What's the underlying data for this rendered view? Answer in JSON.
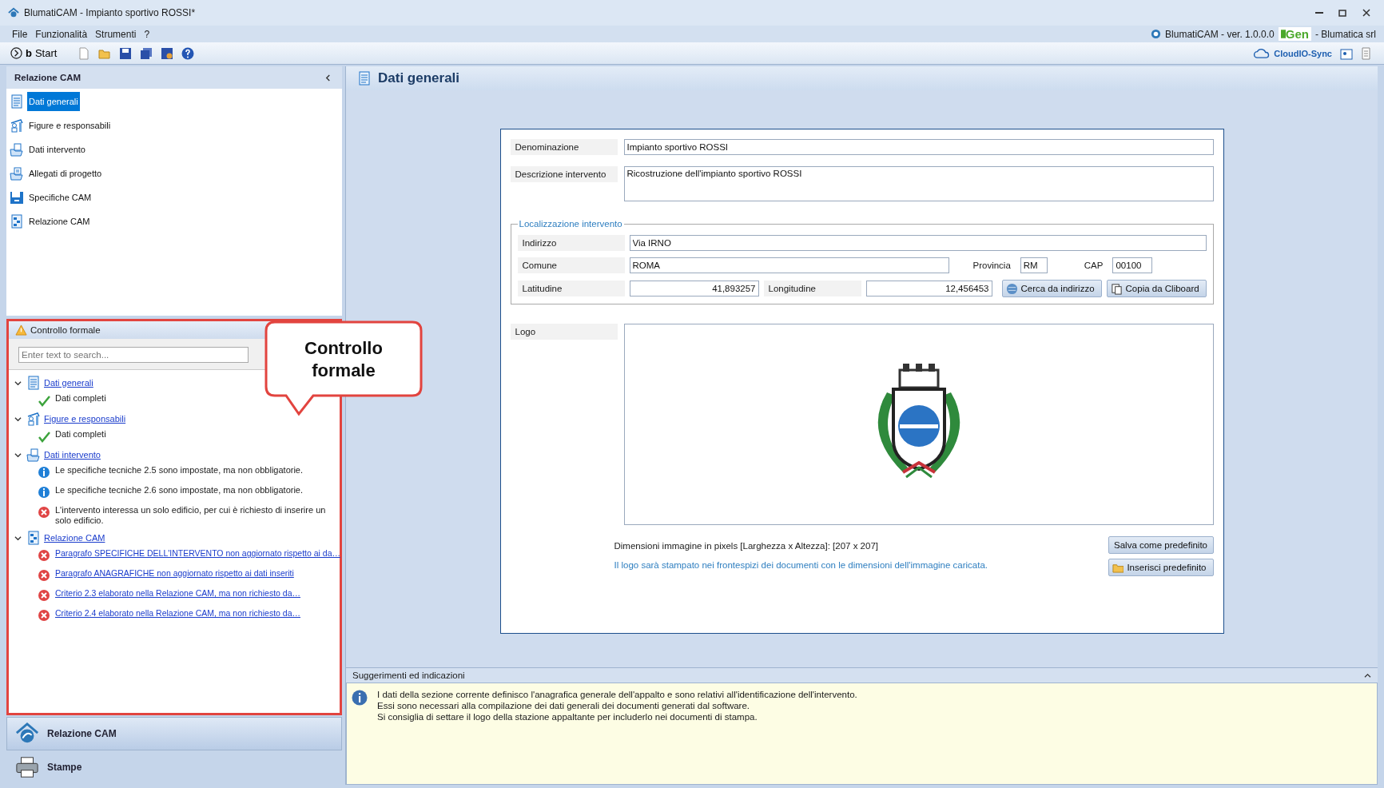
{
  "window": {
    "title": "BlumatiCAM - Impianto sportivo ROSSI*"
  },
  "menu": [
    "File",
    "Funzionalità",
    "Strumenti",
    "?"
  ],
  "app_info": {
    "product": "BlumatiCAM - ver. 1.0.0.0",
    "badge": "Gen",
    "company": "- Blumatica srl"
  },
  "toolbar": {
    "start": "**b**Start",
    "sync": "CloudIO-Sync"
  },
  "sidebar": {
    "title": "Relazione CAM",
    "items": [
      {
        "label": "Dati generali",
        "kind": "document",
        "selected": true
      },
      {
        "label": "Figure e responsabili",
        "kind": "people",
        "selected": false
      },
      {
        "label": "Dati intervento",
        "kind": "folder",
        "selected": false
      },
      {
        "label": "Allegati di progetto",
        "kind": "attachment",
        "selected": false
      },
      {
        "label": "Specifiche CAM",
        "kind": "specs",
        "selected": false
      },
      {
        "label": "Relazione CAM",
        "kind": "report",
        "selected": false
      }
    ]
  },
  "check_panel": {
    "title": "Controllo formale",
    "search_placeholder": "Enter text to search...",
    "groups": [
      {
        "label": "Dati generali",
        "kind": "document",
        "expanded": true,
        "children": [
          {
            "kind": "ok",
            "text": "Dati completi",
            "link": false
          }
        ]
      },
      {
        "label": "Figure e responsabili",
        "kind": "people",
        "expanded": true,
        "children": [
          {
            "kind": "ok",
            "text": "Dati completi",
            "link": false
          }
        ]
      },
      {
        "label": "Dati intervento",
        "kind": "folder",
        "expanded": true,
        "children": [
          {
            "kind": "info",
            "text": "Le specifiche tecniche 2.5 sono impostate, ma non obbligatorie.",
            "link": false
          },
          {
            "kind": "info",
            "text": "Le specifiche tecniche 2.6 sono impostate, ma non obbligatorie.",
            "link": false
          },
          {
            "kind": "error",
            "text": "L'intervento interessa un solo edificio, per cui è richiesto di inserire un solo edificio.",
            "link": false
          }
        ]
      },
      {
        "label": "Relazione CAM",
        "kind": "report",
        "expanded": true,
        "children": [
          {
            "kind": "error",
            "text": "Paragrafo SPECIFICHE DELL'INTERVENTO non aggiornato rispetto ai da…",
            "link": true
          },
          {
            "kind": "error",
            "text": "Paragrafo ANAGRAFICHE non aggiornato rispetto ai dati inseriti",
            "link": true
          },
          {
            "kind": "error",
            "text": "Criterio 2.3 elaborato nella Relazione CAM, ma non richiesto da…",
            "link": true
          },
          {
            "kind": "error",
            "text": "Criterio 2.4 elaborato nella Relazione CAM, ma non richiesto da…",
            "link": true
          }
        ]
      }
    ]
  },
  "callout": {
    "text": "Controllo formale"
  },
  "bottom_nav": [
    {
      "label": "Relazione CAM",
      "kind": "house",
      "selected": true
    },
    {
      "label": "Stampe",
      "kind": "printer",
      "selected": false
    }
  ],
  "main": {
    "title": "Dati generali"
  },
  "form": {
    "denominazione": {
      "label": "Denominazione",
      "value": "Impianto sportivo ROSSI"
    },
    "descrizione": {
      "label": "Descrizione intervento",
      "value": "Ricostruzione dell'impianto sportivo ROSSI"
    },
    "location": {
      "legend": "Localizzazione intervento",
      "indirizzo": {
        "label": "Indirizzo",
        "value": "Via IRNO"
      },
      "comune": {
        "label": "Comune",
        "value": "ROMA"
      },
      "provincia": {
        "label": "Provincia",
        "value": "RM"
      },
      "cap": {
        "label": "CAP",
        "value": "00100"
      },
      "latitudine": {
        "label": "Latitudine",
        "value": "41,893257"
      },
      "longitudine": {
        "label": "Longitudine",
        "value": "12,456453"
      },
      "buttons": [
        "Cerca da indirizzo",
        "Copia da Cliboard"
      ]
    },
    "logo": {
      "label": "Logo",
      "kind": "picture",
      "dimensions": "Dimensioni immagine in pixels [Larghezza x Altezza]: [207 x 207]",
      "note": "Il logo sarà stampato nei frontespizi dei documenti con le dimensioni dell'immagine caricata.",
      "buttons": [
        "Salva come predefinito",
        "Inserisci predefinito"
      ]
    }
  },
  "suggestions": {
    "title": "Suggerimenti ed indicazioni",
    "lines": [
      "I dati della sezione corrente definisco l'anagrafica generale dell'appalto e sono relativi all'identificazione dell'intervento.",
      "Essi sono necessari alla compilazione dei dati generali dei documenti generati dal software.",
      "Si consiglia di settare il logo della stazione appaltante per includerlo nei documenti di stampa."
    ]
  }
}
